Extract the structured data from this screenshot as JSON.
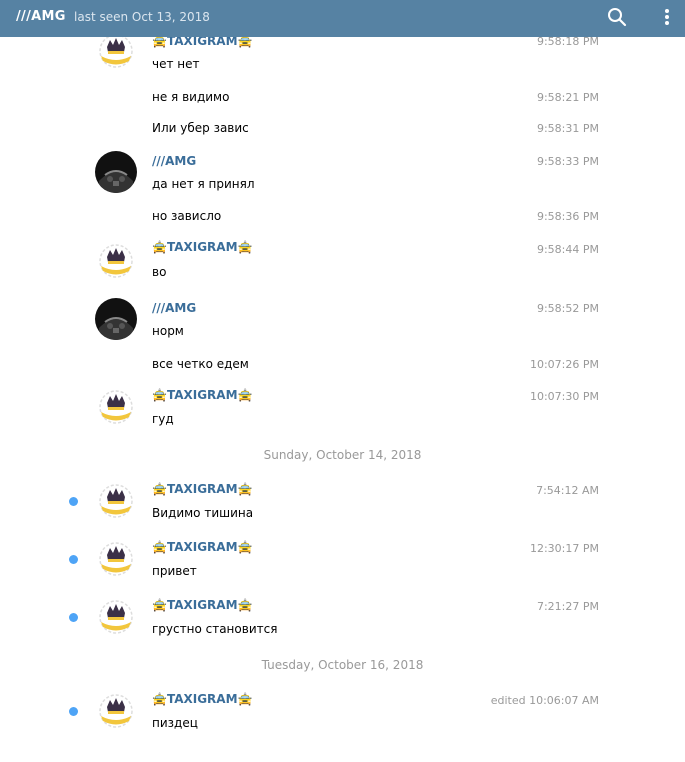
{
  "header": {
    "chat_name": "///AMG",
    "status": "last seen Oct 13, 2018",
    "search_icon": "search-icon",
    "menu_icon": "more-vertical-icon",
    "bg_color": "#5682a3"
  },
  "senders": {
    "taxi": "🚖TAXIGRAM🚖",
    "amg": "///AMG"
  },
  "messages": [
    {
      "sender": "taxi",
      "text": "чет нет",
      "time": "9:58:18 PM"
    },
    {
      "text": "не я видимо",
      "time": "9:58:21 PM"
    },
    {
      "text": "Или убер завис",
      "time": "9:58:31 PM"
    },
    {
      "sender": "amg",
      "text": "да нет я принял",
      "time": "9:58:33 PM"
    },
    {
      "text": "но зависло",
      "time": "9:58:36 PM"
    },
    {
      "sender": "taxi",
      "text": "во",
      "time": "9:58:44 PM"
    },
    {
      "sender": "amg",
      "text": "норм",
      "time": "9:58:52 PM"
    },
    {
      "text": "все четко едем",
      "time": "10:07:26 PM"
    },
    {
      "sender": "taxi",
      "text": "гуд",
      "time": "10:07:30 PM"
    },
    {
      "sender": "taxi",
      "text": "Видимо тишина",
      "time": "7:54:12 AM",
      "unread": true
    },
    {
      "sender": "taxi",
      "text": "привет",
      "time": "12:30:17 PM",
      "unread": true
    },
    {
      "sender": "taxi",
      "text": "грустно становится",
      "time": "7:21:27 PM",
      "unread": true
    },
    {
      "sender": "taxi",
      "text": "пиздец",
      "time": "edited 10:06:07 AM",
      "unread": true
    }
  ],
  "date_separators": [
    "Sunday, October 14, 2018",
    "Tuesday, October 16, 2018"
  ],
  "colors": {
    "sender_name": "#3a6d99",
    "unread_dot": "#4ea4f6",
    "timestamp": "#999999"
  }
}
